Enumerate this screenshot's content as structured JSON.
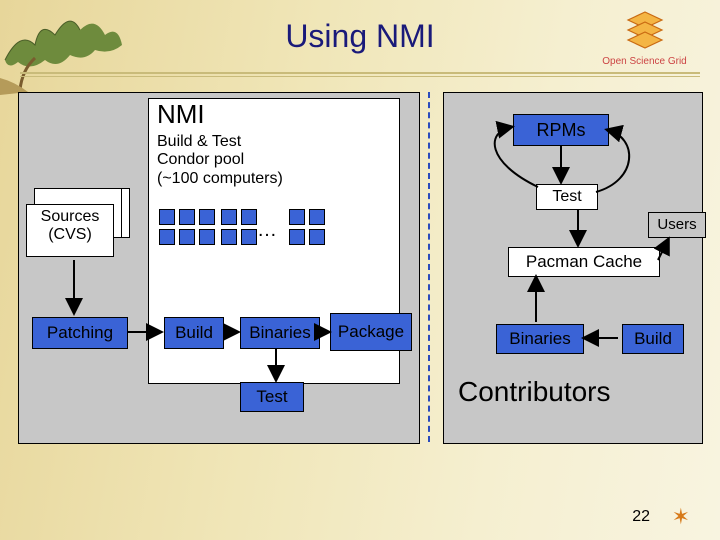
{
  "title": "Using NMI",
  "logo_text": "Open Science Grid",
  "page_number": "22",
  "nmi": {
    "heading": "NMI",
    "condor_line1": "Build & Test",
    "condor_line2": "Condor pool",
    "condor_line3": "(~100 computers)",
    "ellipsis": "…"
  },
  "sources": {
    "line1": "Sources",
    "line2": "(CVS)"
  },
  "left": {
    "patching": "Patching",
    "build": "Build",
    "binaries": "Binaries",
    "package": "Package",
    "test": "Test"
  },
  "right": {
    "rpms": "RPMs",
    "test": "Test",
    "users": "Users",
    "pacman": "Pacman Cache",
    "binaries": "Binaries",
    "build": "Build",
    "contributors": "Contributors"
  }
}
